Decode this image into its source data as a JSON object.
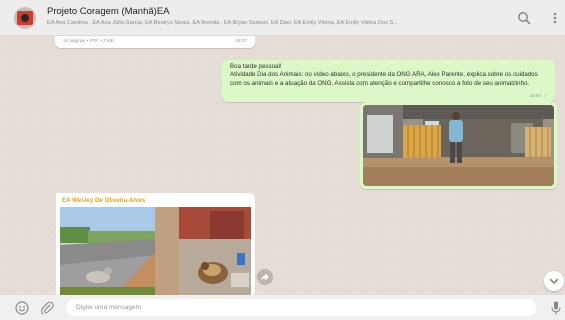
{
  "header": {
    "title": "Projeto Coragem (Manhã)EA",
    "participants": "EA Ana Carolina , EA Ana Júlia Garcia, EA Beatrys Sinais, EA Brenda , EA Bryan Samuel, EA Davi, EA Emily Vitória, EA Emily Vitória Dos S..."
  },
  "messages": {
    "previous": {
      "meta": "18 páginas • PDF • 3 MB",
      "time": "08:07"
    },
    "outgoing": {
      "text": "Boa tarde pessoal!\nAtividade Dia dos Animais: no vídeo abaixo, o presidente da ONG ARA, Alex Parente, explica sobre os cuidados com os animais e a atuação da ONG. Assista com atenção e compartilhe conosco a foto de seu animalzinho.",
      "time": "15:50"
    },
    "incoming": {
      "sender": "EA Wesley De Oliveira Alves"
    }
  },
  "composer": {
    "placeholder": "Digite uma mensagem"
  },
  "icons": {
    "search": "search-icon",
    "menu": "kebab-menu-icon",
    "emoji": "emoji-icon",
    "attach": "paperclip-icon",
    "mic": "microphone-icon",
    "forward": "forward-icon",
    "scroll": "chevron-down-icon"
  },
  "colors": {
    "header_bg": "#ededed",
    "chat_bg": "#e5ddd5",
    "outgoing_bubble": "#dcf8c6",
    "incoming_bubble": "#ffffff",
    "sender_name": "#e3a617",
    "read_tick": "#4fc3f7"
  }
}
